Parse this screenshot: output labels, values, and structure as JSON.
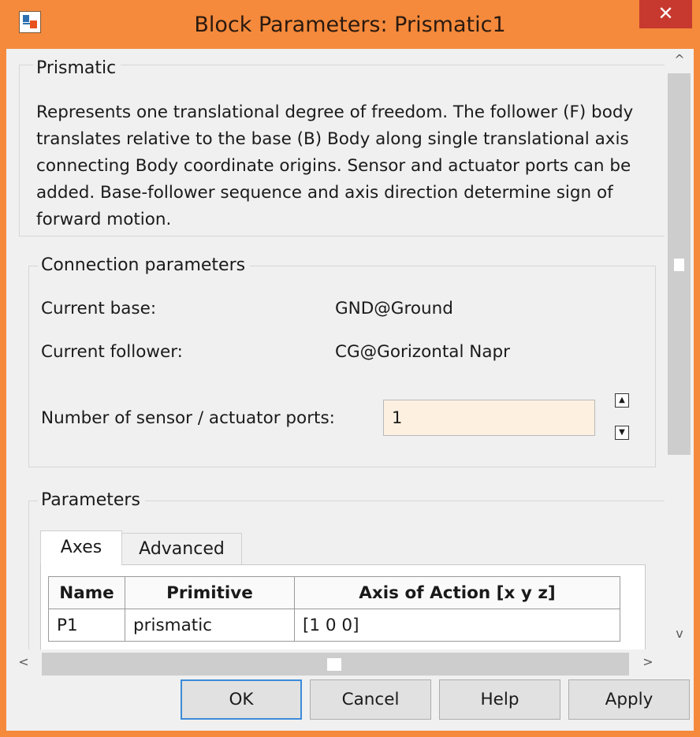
{
  "window": {
    "title": "Block Parameters: Prismatic1",
    "close_glyph": "✕"
  },
  "prismatic": {
    "legend": "Prismatic",
    "description": "Represents one translational degree of freedom. The follower (F) body translates relative to the base (B) Body along single translational axis connecting Body coordinate origins. Sensor and actuator ports can be added. Base-follower sequence and axis direction determine sign of forward motion."
  },
  "connection": {
    "legend": "Connection parameters",
    "current_base_label": "Current base:",
    "current_base_value": "GND@Ground",
    "current_follower_label": "Current follower:",
    "current_follower_value": "CG@Gorizontal Napr",
    "ports_label": "Number of sensor / actuator ports:",
    "ports_value": "1"
  },
  "parameters": {
    "legend": "Parameters",
    "tabs": [
      {
        "label": "Axes",
        "active": true
      },
      {
        "label": "Advanced",
        "active": false
      }
    ],
    "table": {
      "headers": [
        "Name",
        "Primitive",
        "Axis of Action [x y z]"
      ],
      "rows": [
        [
          "P1",
          "prismatic",
          "[1 0 0]"
        ]
      ]
    }
  },
  "buttons": {
    "ok": "OK",
    "cancel": "Cancel",
    "help": "Help",
    "apply": "Apply"
  },
  "icons": {
    "spin_up": "▲",
    "spin_down": "▼",
    "scroll_up": "^",
    "scroll_down": "v",
    "scroll_left": "<",
    "scroll_right": ">"
  },
  "colors": {
    "titlebar": "#f58a3c",
    "close": "#c7392f",
    "input_bg": "#fdf0e0",
    "default_button_border": "#3c8bd9"
  }
}
